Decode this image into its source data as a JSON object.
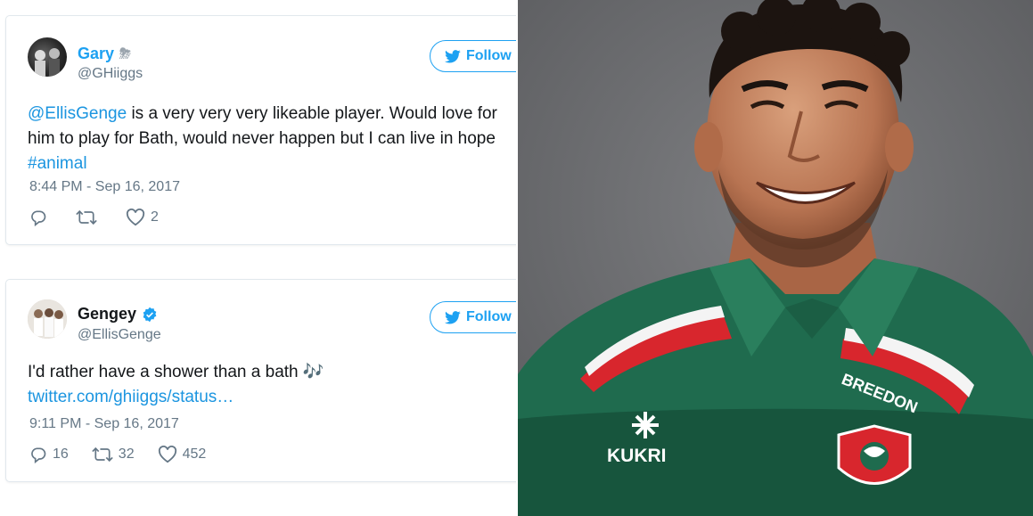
{
  "tweets": [
    {
      "name": "Gary",
      "name_emoji": "⛈",
      "handle": "@GHiiggs",
      "follow_label": "Follow",
      "mention": "@EllisGenge",
      "text_line1": " is a very very very likeable player. Would love for",
      "text_line2": "him to play for Bath, would never happen but I can live in hope",
      "hashtag": "#animal",
      "timestamp": "8:44 PM - Sep 16, 2017",
      "replies": "",
      "retweets": "",
      "likes": "2"
    },
    {
      "name": "Gengey",
      "verified": true,
      "handle": "@EllisGenge",
      "follow_label": "Follow",
      "text_line1": "I'd rather have a shower than a bath",
      "emoji": "🎶",
      "link": "twitter.com/ghiiggs/status…",
      "timestamp": "9:11 PM - Sep 16, 2017",
      "replies": "16",
      "retweets": "32",
      "likes": "452"
    }
  ],
  "photo": {
    "shirt_brand": "KUKRI",
    "shirt_sponsor": "BREEDON"
  },
  "colors": {
    "twitter_blue": "#1da1f2",
    "link_blue": "#1b95e0",
    "muted_gray": "#657786",
    "shirt_green": "#1f6b4e",
    "shirt_red": "#d8262d",
    "photo_bg": "#6f7073"
  },
  "icons": [
    "twitter-bird-icon",
    "reply-icon",
    "retweet-icon",
    "heart-icon",
    "verified-badge-icon"
  ]
}
